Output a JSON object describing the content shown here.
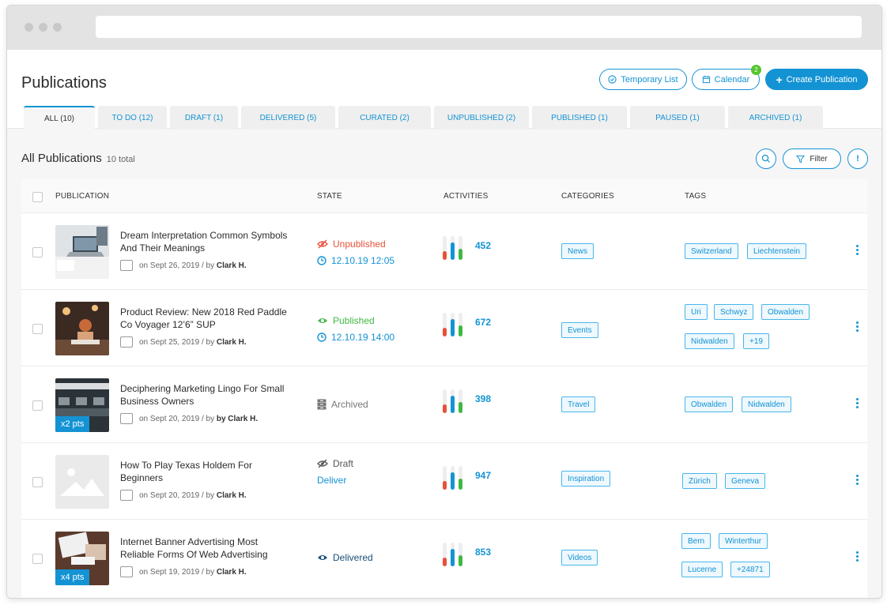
{
  "header": {
    "title": "Publications",
    "temporary_list": "Temporary List",
    "calendar": "Calendar",
    "calendar_badge": "2",
    "create": "Create Publication"
  },
  "tabs": [
    {
      "label": "ALL (10)"
    },
    {
      "label": "TO DO (12)"
    },
    {
      "label": "DRAFT (1)"
    },
    {
      "label": "DELIVERED (5)"
    },
    {
      "label": "CURATED (2)"
    },
    {
      "label": "UNPUBLISHED (2)"
    },
    {
      "label": "PUBLISHED (1)"
    },
    {
      "label": "PAUSED (1)"
    },
    {
      "label": "ARCHIVED (1)"
    }
  ],
  "section": {
    "title": "All Publications",
    "count": "10 total",
    "filter": "Filter"
  },
  "columns": {
    "publication": "PUBLICATION",
    "state": "STATE",
    "activities": "ACTIVITIES",
    "categories": "CATEGORIES",
    "tags": "TAGS"
  },
  "rows": [
    {
      "title": "Dream Interpretation Common Symbols And Their Meanings",
      "date": "on Sept 26, 2019 / by",
      "author": "Clark H.",
      "state": "Unpublished",
      "state_color": "#e8503a",
      "schedule": "12.10.19 12:05",
      "activities": "452",
      "category": "News",
      "tags": [
        "Switzerland",
        "Liechtenstein"
      ]
    },
    {
      "title": "Product Review: New 2018 Red Paddle Co Voyager 12’6” SUP",
      "date": "on Sept 25, 2019 / by",
      "author": "Clark H.",
      "state": "Published",
      "state_color": "#3fb843",
      "schedule": "12.10.19 14:00",
      "activities": "672",
      "category": "Events",
      "tags": [
        "Uri",
        "Schwyz",
        "Obwalden",
        "Nidwalden",
        "+19"
      ]
    },
    {
      "title": "Deciphering Marketing Lingo For Small Business Owners",
      "date": "on Sept 20, 2019 / by",
      "author": "by Clark H.",
      "pts": "x2 pts",
      "state": "Archived",
      "state_color": "#777777",
      "activities": "398",
      "category": "Travel",
      "tags": [
        "Obwalden",
        "Nidwalden"
      ]
    },
    {
      "title": "How To Play Texas Holdem For Beginners",
      "date": "on Sept 20, 2019 / by",
      "author": "Clark H.",
      "state": "Draft",
      "state_color": "#555555",
      "schedule": "Deliver",
      "activities": "947",
      "category": "Inspiration",
      "tags": [
        "Zürich",
        "Geneva"
      ]
    },
    {
      "title": "Internet Banner Advertising Most Reliable Forms Of Web Advertising",
      "date": "on Sept 19, 2019 / by",
      "author": "Clark H.",
      "pts": "x4 pts",
      "state": "Delivered",
      "state_color": "#1a4f7a",
      "activities": "853",
      "category": "Videos",
      "tags": [
        "Bern",
        "Winterthur",
        "Lucerne",
        "+24871"
      ]
    }
  ],
  "colors": {
    "accent": "#1393d4",
    "bar_red": "#e8503a",
    "bar_blue": "#1393d4",
    "bar_green": "#3fb843"
  }
}
